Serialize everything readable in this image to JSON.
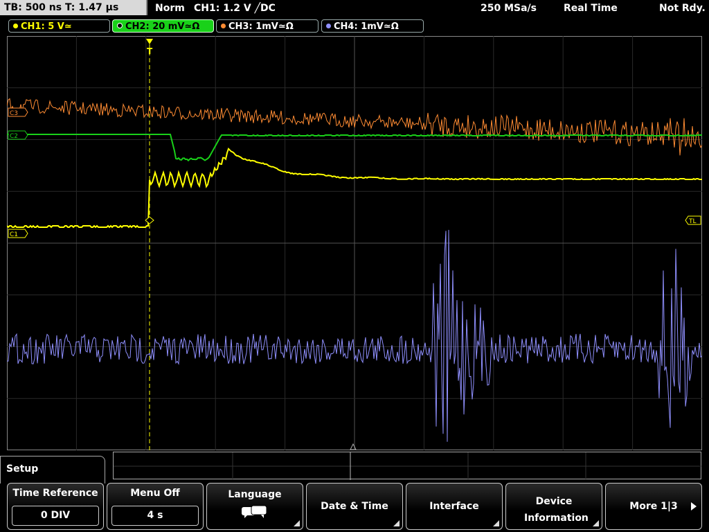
{
  "status": {
    "timebase": "TB: 500 ns   T: 1.47 µs",
    "trigger_mode": "Norm",
    "trigger_info": "CH1: 1.2 V",
    "trigger_coupling": "DC",
    "sample_rate": "250 MSa/s",
    "acq_mode": "Real Time",
    "state": "Not Rdy."
  },
  "channels": [
    {
      "label": "CH1: 5 V≃",
      "color": "#ffff00"
    },
    {
      "label": "CH2: 20 mV≃Ω",
      "color": "#19d119"
    },
    {
      "label": "CH3: 1mV≃Ω",
      "color": "#ff8c33"
    },
    {
      "label": "CH4: 1mV≃Ω",
      "color": "#9090ff"
    }
  ],
  "markers": {
    "trigger_top": "T",
    "ch1": "C1",
    "ch2": "C2",
    "ch3": "C3",
    "trigger_level": "TL"
  },
  "menu": {
    "title": "Setup",
    "softkeys": [
      {
        "label": "Time Reference",
        "value": "0 DIV"
      },
      {
        "label": "Menu Off",
        "value": "4 s"
      },
      {
        "label": "Language",
        "icon": "speech-bubbles-icon"
      },
      {
        "label": "Date & Time"
      },
      {
        "label": "Interface"
      },
      {
        "label": "Device Information"
      },
      {
        "label": "More 1|3"
      }
    ]
  }
}
